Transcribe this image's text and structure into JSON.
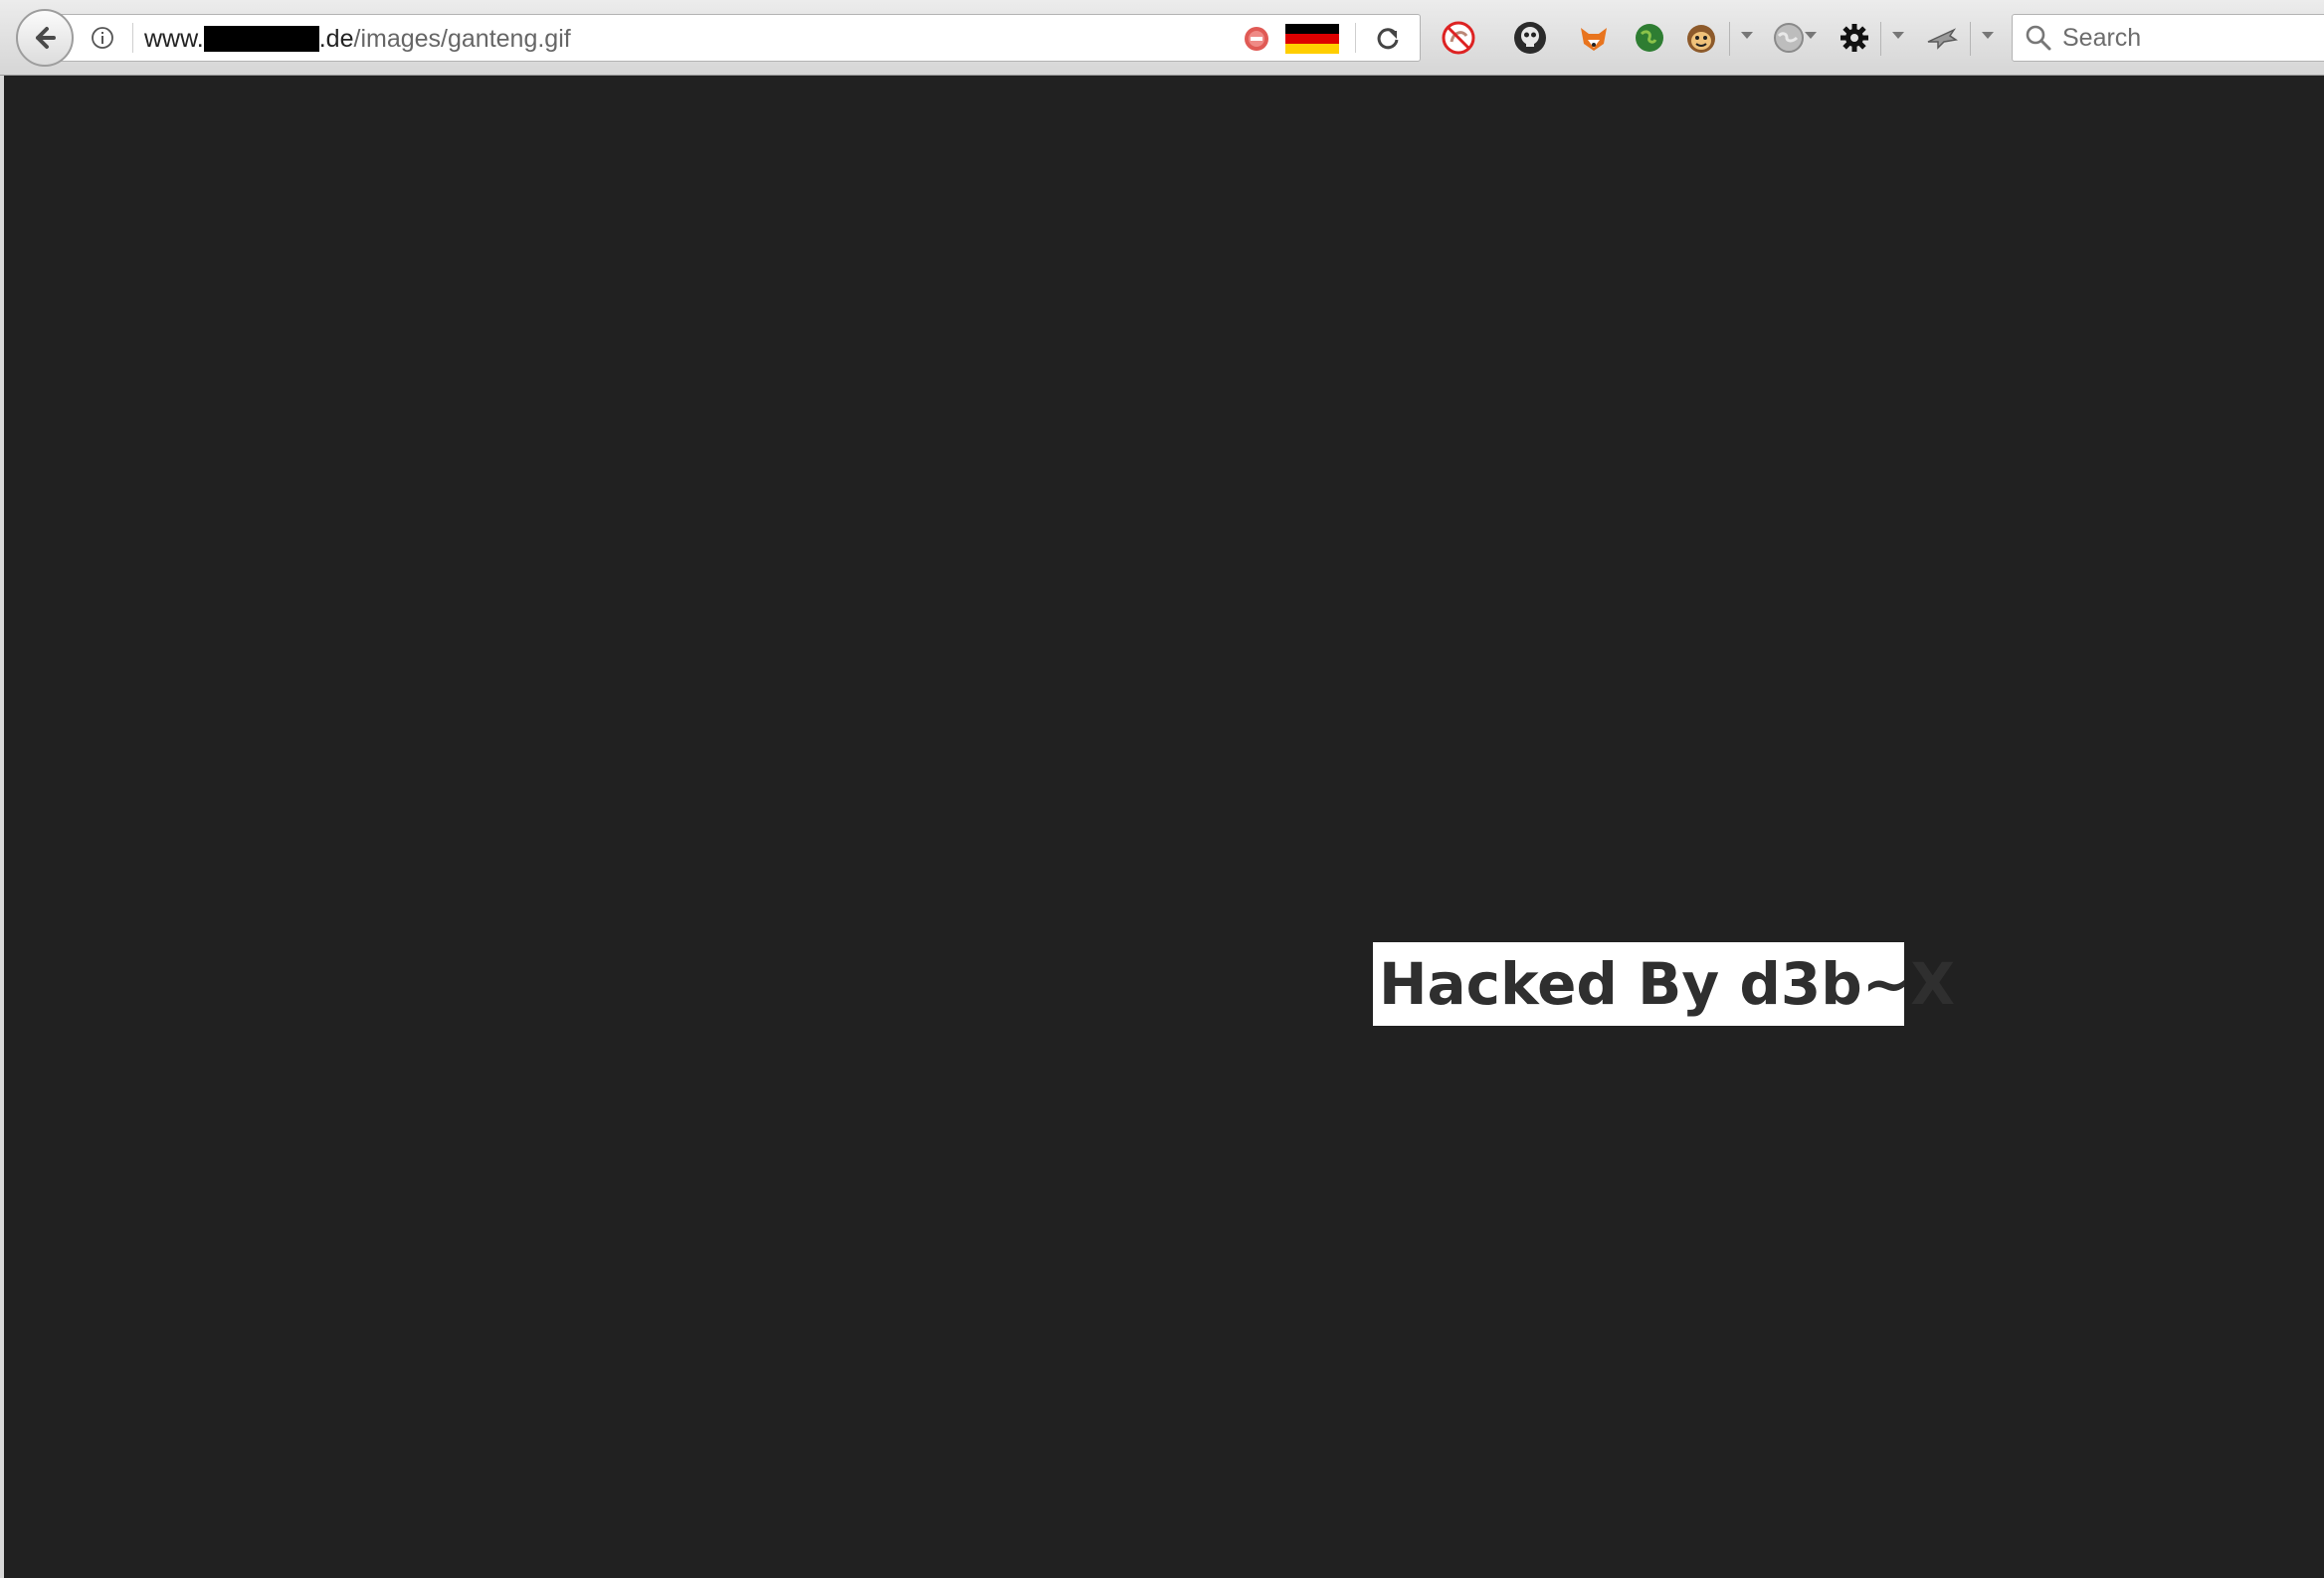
{
  "browser": {
    "url_prefix": "www.",
    "url_domain_suffix": ".de",
    "url_path": "/images/ganteng.gif",
    "search_placeholder": "Search"
  },
  "toolbar_icons": [
    "back-arrow-icon",
    "site-info-icon",
    "stop-red-icon",
    "germany-flag-icon",
    "reload-icon",
    "no-script-icon",
    "skull-icon",
    "fox-icon",
    "green-globe-icon",
    "monkey-icon",
    "gray-globe-icon",
    "gear-icon",
    "plane-icon",
    "search-icon"
  ],
  "flag_colors": [
    "#000000",
    "#dd0000",
    "#ffce00"
  ],
  "page": {
    "background": "#212121",
    "message": "Hacked By d3b~X"
  }
}
